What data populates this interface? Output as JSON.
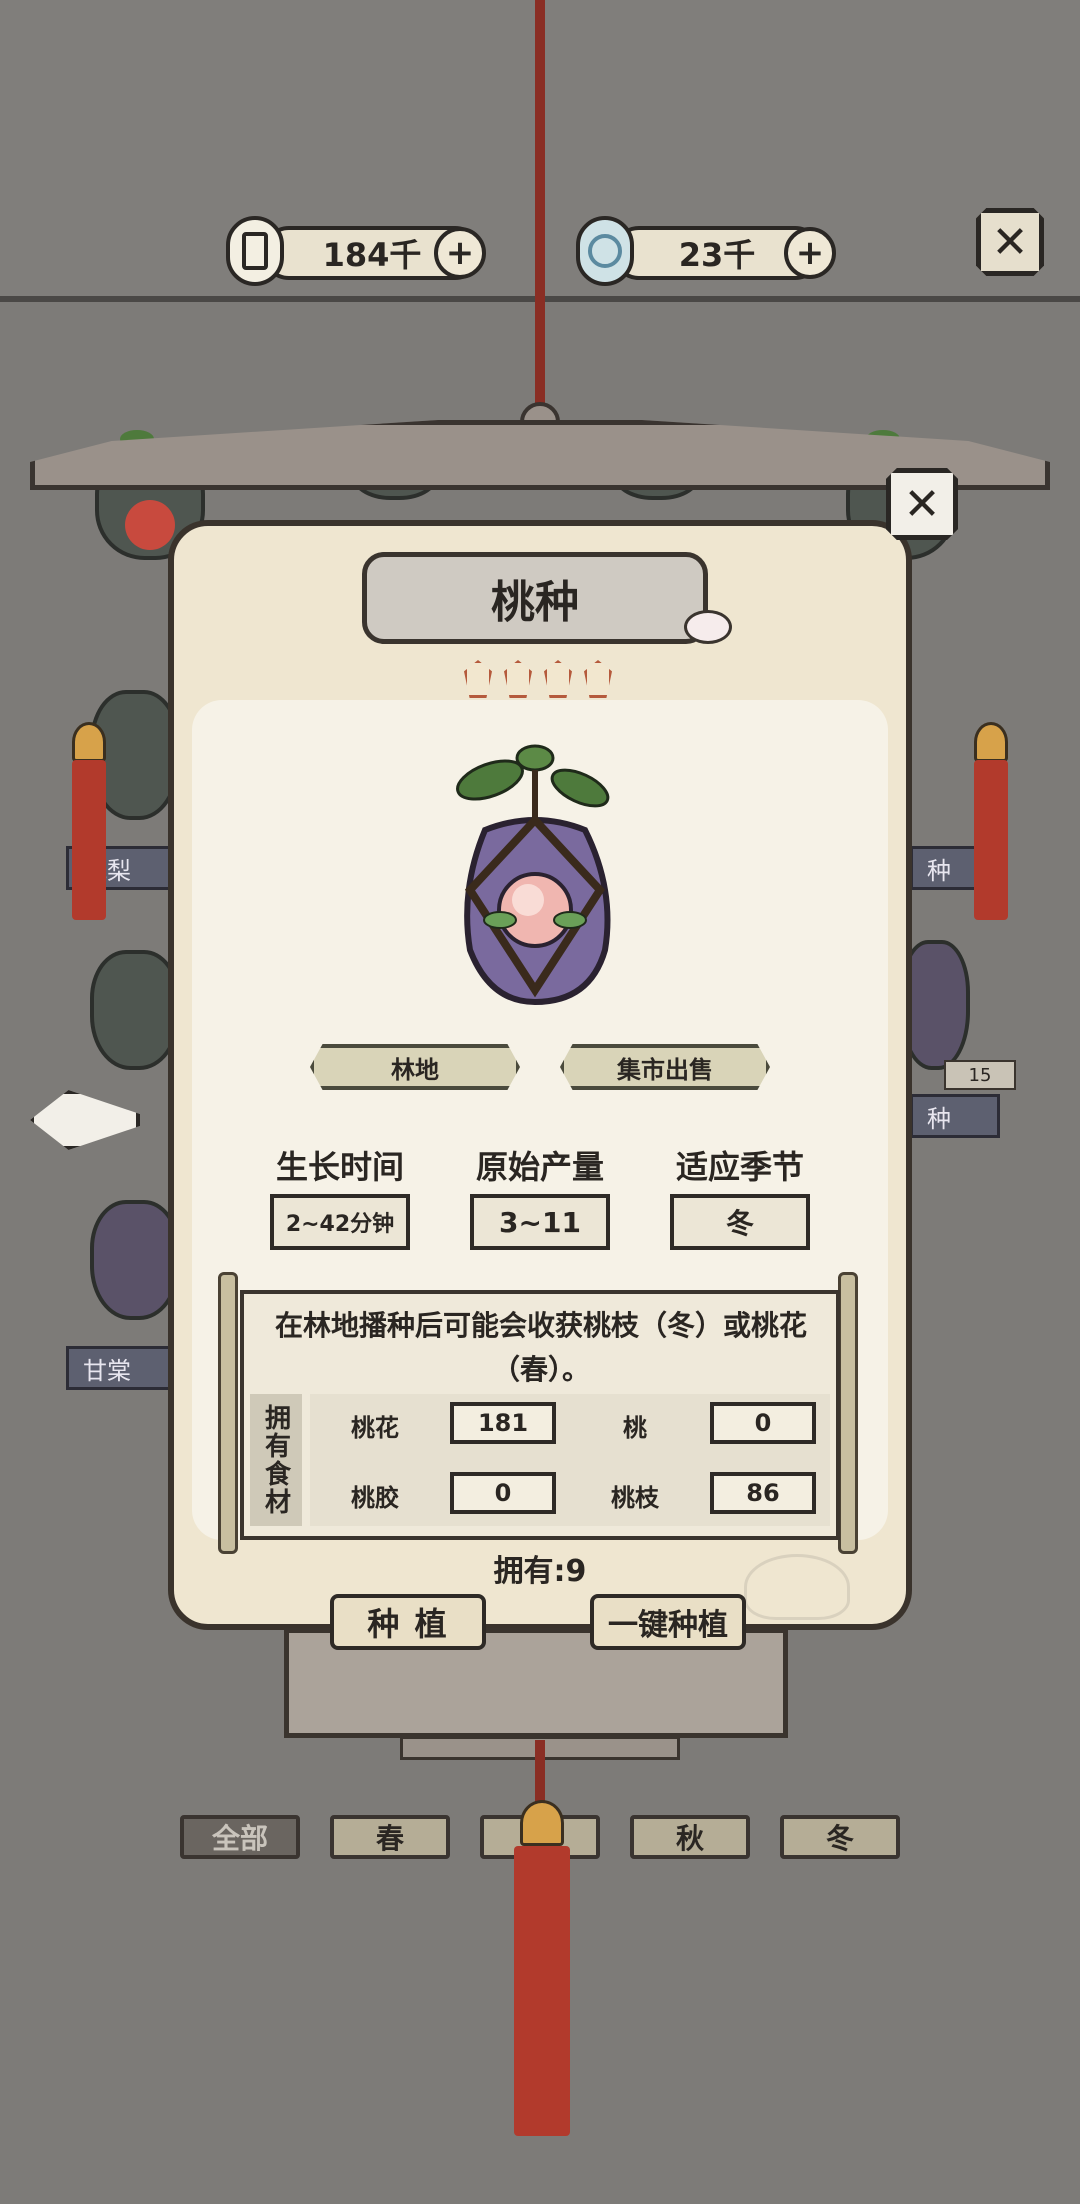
{
  "header": {
    "coins": {
      "value": "184千",
      "icon": "coin-icon"
    },
    "gems": {
      "value": "23千",
      "icon": "spirit-orb-icon"
    },
    "plus_label": "+",
    "close_label": "✕"
  },
  "background": {
    "left_labels": [
      "凤梨",
      "甘棠"
    ],
    "right_labels": [
      "种",
      "种"
    ],
    "count_badge": "15"
  },
  "dialog": {
    "close_label": "✕",
    "title": "桃种",
    "stars": 4,
    "tags": [
      "林地",
      "集市出售"
    ],
    "stats": [
      {
        "label": "生长时间",
        "value": "2~42分钟"
      },
      {
        "label": "原始产量",
        "value": "3~11"
      },
      {
        "label": "适应季节",
        "value": "冬"
      }
    ],
    "description": "在林地播种后可能会收获桃枝（冬）或桃花（春）。",
    "inventory": {
      "header": "拥有食材",
      "items": [
        {
          "name": "桃花",
          "count": "181"
        },
        {
          "name": "桃",
          "count": "0"
        },
        {
          "name": "桃胶",
          "count": "0"
        },
        {
          "name": "桃枝",
          "count": "86"
        }
      ]
    },
    "owned_text": "拥有:9",
    "buttons": {
      "plant": "种 植",
      "plant_all": "一键种植"
    }
  },
  "filters": [
    {
      "label": "全部",
      "active": true
    },
    {
      "label": "春",
      "active": false
    },
    {
      "label": "",
      "active": false
    },
    {
      "label": "秋",
      "active": false
    },
    {
      "label": "冬",
      "active": false
    }
  ],
  "colors": {
    "accent_red": "#b23a2c",
    "parchment": "#efe6d0",
    "ink": "#2a2622"
  }
}
